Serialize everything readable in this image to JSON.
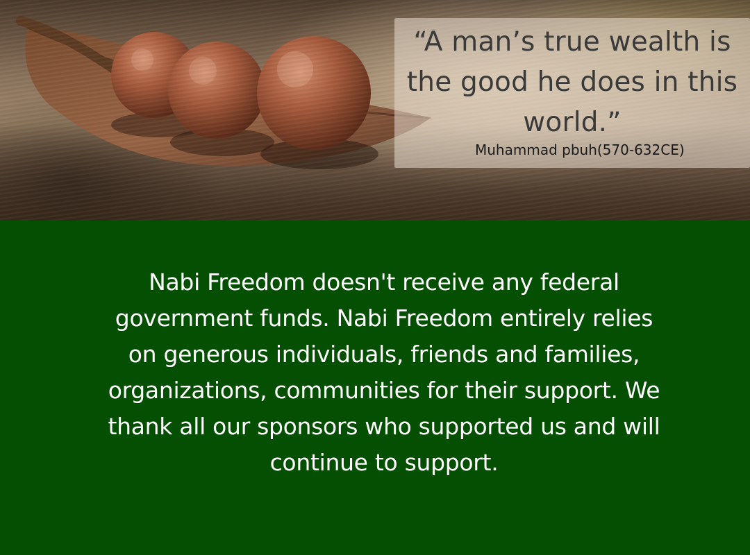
{
  "banner": {
    "image_subject": "three round seeds resting on a dried leaf on a wooden table",
    "quote": {
      "text": "“A man’s true wealth is the good he does in this world.”",
      "author": "Muhammad pbuh(570-632CE)"
    }
  },
  "message": {
    "text": "Nabi Freedom doesn't receive any federal government funds. Nabi Freedom entirely relies on generous individuals, friends and families, organizations, communities for their support. We thank all our sponsors who supported us and will continue to support."
  },
  "colors": {
    "panel_background": "#044f02",
    "message_text": "#ffffff",
    "quote_text": "#3a3a3a"
  }
}
